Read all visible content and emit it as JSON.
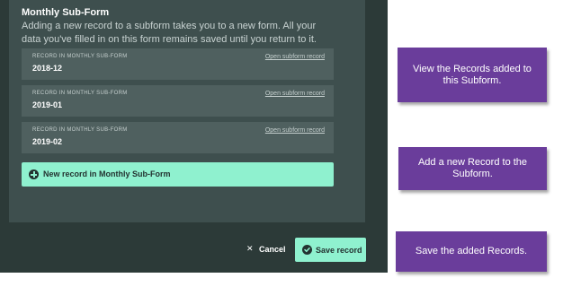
{
  "form": {
    "title": "Monthly Sub-Form",
    "description": "Adding a new record to a subform takes you to a new form. All your data you've filled in on this form remains saved until you return to it."
  },
  "records": [
    {
      "label": "RECORD IN MONTHLY SUB-FORM",
      "value": "2018-12",
      "link": "Open subform record"
    },
    {
      "label": "RECORD IN MONTHLY SUB-FORM",
      "value": "2019-01",
      "link": "Open subform record"
    },
    {
      "label": "RECORD IN MONTHLY SUB-FORM",
      "value": "2019-02",
      "link": "Open subform record"
    }
  ],
  "new_record": {
    "label": "New record in Monthly Sub-Form",
    "icon": "plus-circle-icon"
  },
  "footer": {
    "cancel_label": "Cancel",
    "cancel_icon": "close-icon",
    "save_label": "Save record",
    "save_icon": "check-circle-icon"
  },
  "callouts": [
    {
      "text": "View the Records added to this Subform."
    },
    {
      "text": "Add a new Record to the Subform."
    },
    {
      "text": "Save the added Records."
    }
  ],
  "colors": {
    "background": "#2c3a38",
    "panel": "#3e4f4e",
    "record_bg": "#4f605f",
    "accent": "#8ff1cf",
    "callout": "#6a3d9b"
  }
}
